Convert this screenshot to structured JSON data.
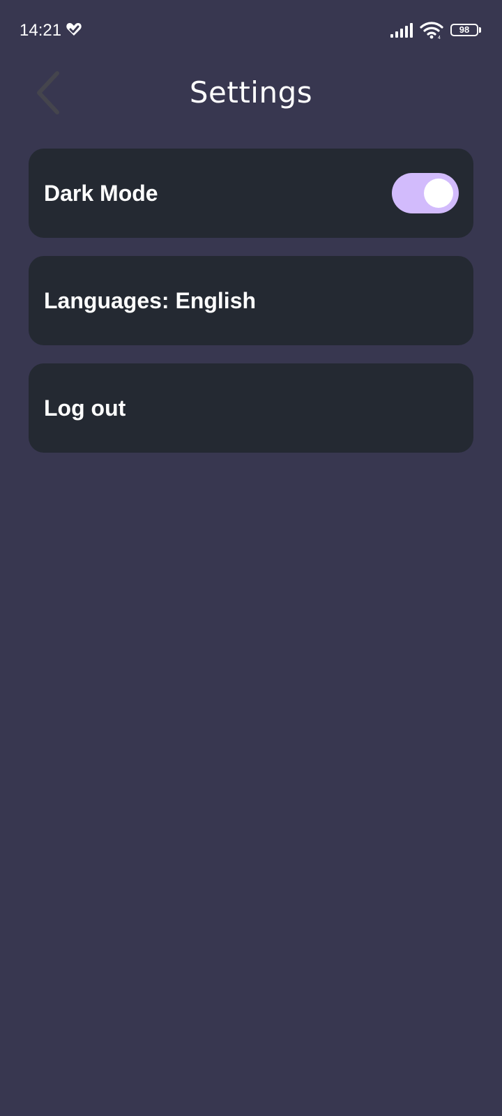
{
  "status_bar": {
    "time": "14:21",
    "app_icon": "heart-check-icon",
    "signal_icon": "cell-signal-icon",
    "wifi_icon": "wifi-icon",
    "battery_level": "98"
  },
  "header": {
    "title": "Settings",
    "back_icon": "chevron-left-icon"
  },
  "settings": {
    "dark_mode": {
      "label": "Dark Mode",
      "enabled": true
    },
    "languages": {
      "label": "Languages: English"
    },
    "logout": {
      "label": "Log out"
    }
  },
  "colors": {
    "background": "#383750",
    "card": "#242932",
    "toggle_track": "#d2bbfc",
    "toggle_knob": "#ffffff",
    "text": "#ffffff",
    "back_icon": "#45454d"
  }
}
